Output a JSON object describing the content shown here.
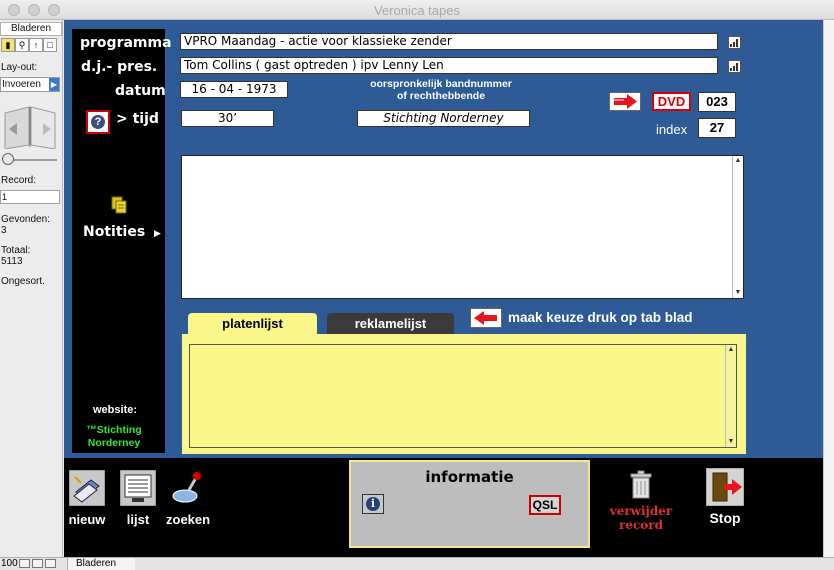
{
  "window": {
    "title": "Veronica tapes"
  },
  "status": {
    "mode": "Bladeren",
    "layout_label": "Lay-out:",
    "layout_value": "Invoeren",
    "record_label": "Record:",
    "record_value": "1",
    "found_label": "Gevonden:",
    "found_value": "3",
    "total_label": "Totaal:",
    "total_value": "5113",
    "sort_state": "Ongesort.",
    "zoom": "100",
    "bottom_mode": "Bladeren"
  },
  "form": {
    "labels": {
      "programma": "programma",
      "dj": "d.j.- pres.",
      "datum": "datum",
      "tijd": "> tijd",
      "oorspronkelijk": "oorspronkelijk bandnummer",
      "rechthebbende": "of rechthebbende",
      "index": "index",
      "notities": "Notities",
      "website": "website:",
      "stichting": "™Stichting Norderney"
    },
    "programma": "VPRO Maandag -  actie voor klassieke zender",
    "dj": "Tom Collins ( gast optreden ) ipv Lenny Len",
    "datum": "16 - 04 - 1973",
    "tijd": "30’",
    "rechthebbende": "Stichting Norderney",
    "dvd_label": "DVD",
    "dvd_number": "023",
    "index": "27",
    "notes": ""
  },
  "tabs": {
    "platenlijst": "platenlijst",
    "reklamelijst": "reklamelijst",
    "hint": "maak keuze druk op tab blad"
  },
  "toolbar": {
    "nieuw": "nieuw",
    "lijst": "lijst",
    "zoeken": "zoeken",
    "informatie": "informatie",
    "qsl": "QSL",
    "verwijder": "verwijder",
    "record": "record",
    "stop": "Stop"
  },
  "colors": {
    "panel_blue": "#2e5a95",
    "tab_yellow": "#faf68a",
    "accent_red": "#d00000",
    "website_green": "#35e635"
  }
}
